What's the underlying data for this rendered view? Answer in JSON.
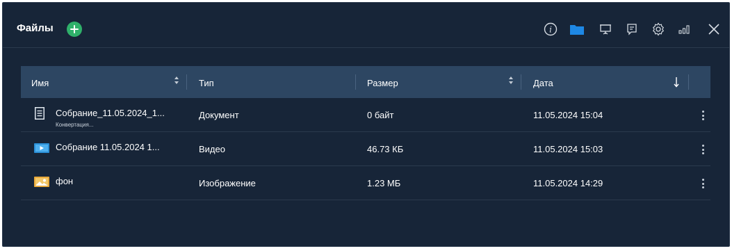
{
  "header": {
    "title": "Файлы",
    "icons": [
      "info-icon",
      "folder-icon",
      "screen-share-icon",
      "chat-icon",
      "gear-icon",
      "signal-icon",
      "close-icon"
    ]
  },
  "colors": {
    "background": "#172538",
    "table_header": "#2d4662",
    "accent_green": "#2fb06a",
    "folder_blue": "#1e88e5"
  },
  "table": {
    "columns": {
      "name": "Имя",
      "type": "Тип",
      "size": "Размер",
      "date": "Дата"
    },
    "rows": [
      {
        "icon": "document-icon",
        "name": "Собрание_11.05.2024_1...",
        "subtitle": "Конвертация...",
        "type": "Документ",
        "size": "0 байт",
        "date": "11.05.2024 15:04"
      },
      {
        "icon": "video-icon",
        "name": "Собрание 11.05.2024 1...",
        "type": "Видео",
        "size": "46.73 КБ",
        "date": "11.05.2024 15:03"
      },
      {
        "icon": "image-icon",
        "name": "фон",
        "type": "Изображение",
        "size": "1.23 МБ",
        "date": "11.05.2024 14:29"
      }
    ]
  }
}
